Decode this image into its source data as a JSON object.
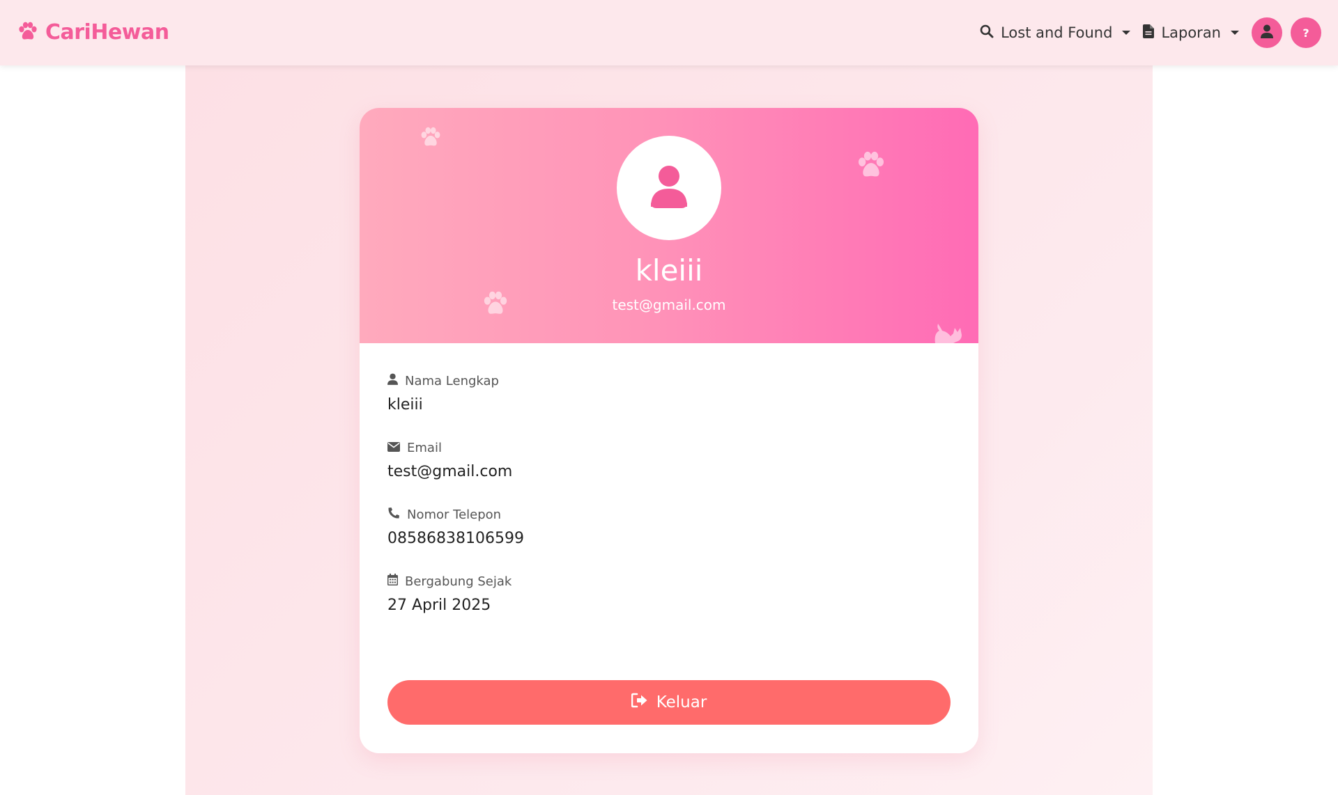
{
  "brand": {
    "name": "CariHewan",
    "color": "#f45c99"
  },
  "nav": {
    "lost_found_label": "Lost and Found",
    "laporan_label": "Laporan",
    "help_label": "?"
  },
  "profile": {
    "name": "kleiii",
    "email": "test@gmail.com"
  },
  "fields": {
    "full_name": {
      "label": "Nama Lengkap",
      "value": "kleiii",
      "icon": "user-icon"
    },
    "email": {
      "label": "Email",
      "value": "test@gmail.com",
      "icon": "envelope-icon"
    },
    "phone": {
      "label": "Nomor Telepon",
      "value": "08586838106599",
      "icon": "phone-icon"
    },
    "joined": {
      "label": "Bergabung Sejak",
      "value": "27 April 2025",
      "icon": "calendar-icon"
    }
  },
  "logout": {
    "label": "Keluar",
    "color": "#ff6b6b"
  }
}
